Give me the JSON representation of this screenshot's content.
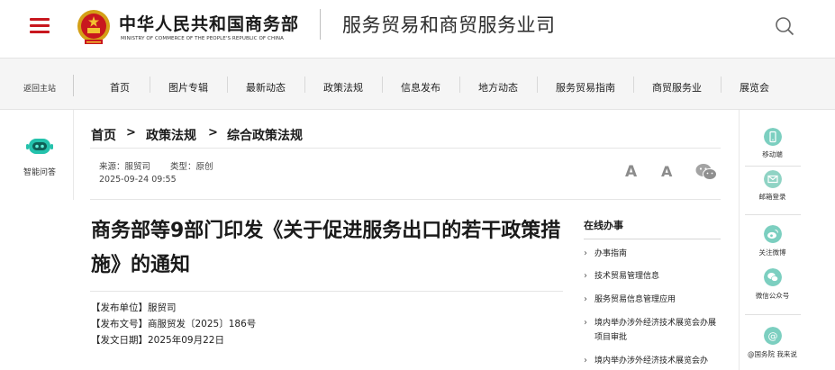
{
  "header": {
    "ministry_cn": "中华人民共和国商务部",
    "ministry_en": "MINISTRY OF COMMERCE OF THE PEOPLE'S REPUBLIC OF CHINA",
    "department": "服务贸易和商贸服务业司",
    "accent_color": "#c8171e"
  },
  "nav": {
    "home": "返回主站",
    "items": [
      "首页",
      "图片专辑",
      "最新动态",
      "政策法规",
      "信息发布",
      "地方动态",
      "服务贸易指南",
      "商贸服务业",
      "展览会"
    ]
  },
  "left_sidebar": {
    "assistant_label": "智能问答"
  },
  "breadcrumb": [
    "首页",
    "政策法规",
    "综合政策法规"
  ],
  "meta": {
    "source_label": "来源：服贸司",
    "type_label": "类型：原创",
    "date": "2025-09-24 09:55",
    "font_large": "A",
    "font_small": "A"
  },
  "article": {
    "title": "商务部等9部门印发《关于促进服务出口的若干政策措施》的通知",
    "issuer": "【发布单位】服贸司",
    "doc_number": "【发布文号】商服贸发〔2025〕186号",
    "issue_date": "【发文日期】2025年09月22日"
  },
  "online_service": {
    "title": "在线办事",
    "items": [
      "办事指南",
      "技术贸易管理信息",
      "服务贸易信息管理应用",
      "境内举办涉外经济技术展览会办展项目审批",
      "境内举办涉外经济技术展览会办"
    ]
  },
  "right_sidebar": {
    "items": [
      {
        "label": "移动端",
        "icon": "mobile-icon",
        "color": "#7ccfc0"
      },
      {
        "label": "邮箱登录",
        "icon": "mail-icon",
        "color": "#8fd3c4"
      },
      {
        "label": "关注微博",
        "icon": "weibo-icon",
        "color": "#7ccfc0"
      },
      {
        "label": "微信公众号",
        "icon": "wechat-icon",
        "color": "#7ccfc0"
      },
      {
        "label": "@国务院 我来说",
        "icon": "at-icon",
        "color": "#7ccfc0"
      }
    ]
  }
}
